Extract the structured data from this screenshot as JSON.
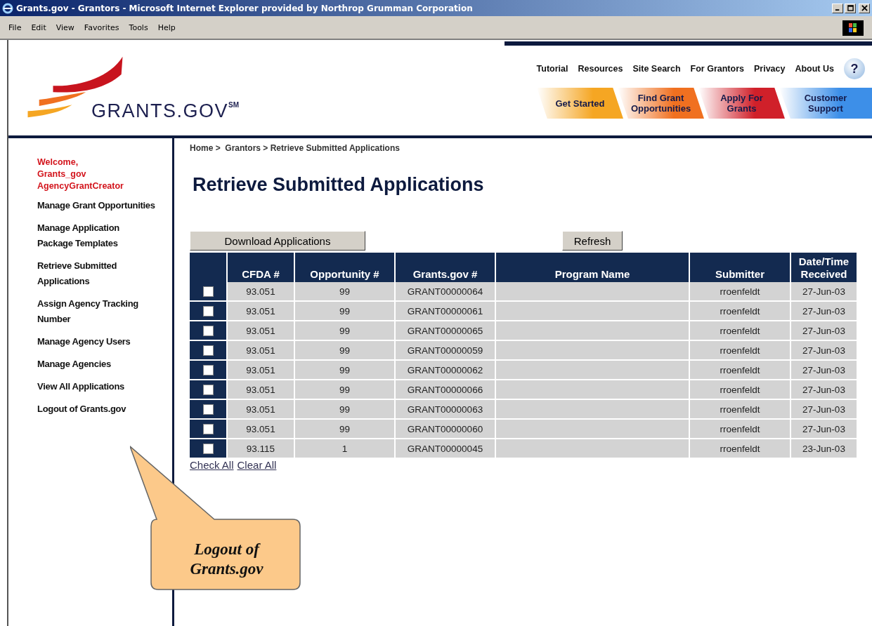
{
  "window": {
    "title": "Grants.gov - Grantors - Microsoft Internet Explorer provided by Northrop Grumman Corporation"
  },
  "menu_bar": [
    "File",
    "Edit",
    "View",
    "Favorites",
    "Tools",
    "Help"
  ],
  "logo": {
    "text": "GRANTS.GOV",
    "mark": "SM"
  },
  "top_links": [
    "Tutorial",
    "Resources",
    "Site Search",
    "For Grantors",
    "Privacy",
    "About Us"
  ],
  "help_button": "?",
  "nav_tabs": [
    {
      "label": "Get Started",
      "color": "#f5a623"
    },
    {
      "label": "Find Grant Opportunities",
      "color": "#f07020"
    },
    {
      "label": "Apply For Grants",
      "color": "#d0202a"
    },
    {
      "label": "Customer Support",
      "color": "#3d8fe8"
    }
  ],
  "sidebar": {
    "welcome": "Welcome, Grants_gov AgencyGrantCreator",
    "items": [
      "Manage Grant Opportunities",
      "Manage Application Package Templates",
      "Retrieve Submitted Applications",
      "Assign Agency Tracking Number",
      "Manage Agency Users",
      "Manage Agencies",
      "View All Applications",
      "Logout of Grants.gov"
    ]
  },
  "breadcrumb": "Home >  Grantors > Retrieve Submitted Applications",
  "page_title": "Retrieve Submitted Applications",
  "buttons": {
    "download": "Download Applications",
    "refresh": "Refresh"
  },
  "table": {
    "columns": [
      "CFDA #",
      "Opportunity #",
      "Grants.gov #",
      "Program Name",
      "Submitter",
      "Date/Time Received"
    ],
    "rows": [
      {
        "checked": false,
        "cfda": "93.051",
        "opportunity": "99",
        "grants_gov": "GRANT00000064",
        "submitter": "rroenfeldt",
        "received": "27-Jun-03"
      },
      {
        "checked": false,
        "cfda": "93.051",
        "opportunity": "99",
        "grants_gov": "GRANT00000061",
        "submitter": "rroenfeldt",
        "received": "27-Jun-03"
      },
      {
        "checked": false,
        "cfda": "93.051",
        "opportunity": "99",
        "grants_gov": "GRANT00000065",
        "submitter": "rroenfeldt",
        "received": "27-Jun-03"
      },
      {
        "checked": false,
        "cfda": "93.051",
        "opportunity": "99",
        "grants_gov": "GRANT00000059",
        "submitter": "rroenfeldt",
        "received": "27-Jun-03"
      },
      {
        "checked": false,
        "cfda": "93.051",
        "opportunity": "99",
        "grants_gov": "GRANT00000062",
        "submitter": "rroenfeldt",
        "received": "27-Jun-03"
      },
      {
        "checked": false,
        "cfda": "93.051",
        "opportunity": "99",
        "grants_gov": "GRANT00000066",
        "submitter": "rroenfeldt",
        "received": "27-Jun-03"
      },
      {
        "checked": false,
        "cfda": "93.051",
        "opportunity": "99",
        "grants_gov": "GRANT00000063",
        "submitter": "rroenfeldt",
        "received": "27-Jun-03"
      },
      {
        "checked": false,
        "cfda": "93.051",
        "opportunity": "99",
        "grants_gov": "GRANT00000060",
        "submitter": "rroenfeldt",
        "received": "27-Jun-03"
      },
      {
        "checked": false,
        "cfda": "93.115",
        "opportunity": "1",
        "grants_gov": "GRANT00000045",
        "submitter": "rroenfeldt",
        "received": "23-Jun-03"
      }
    ]
  },
  "table_links": [
    "Check All",
    "Clear All"
  ],
  "callout": "Logout of Grants.gov"
}
